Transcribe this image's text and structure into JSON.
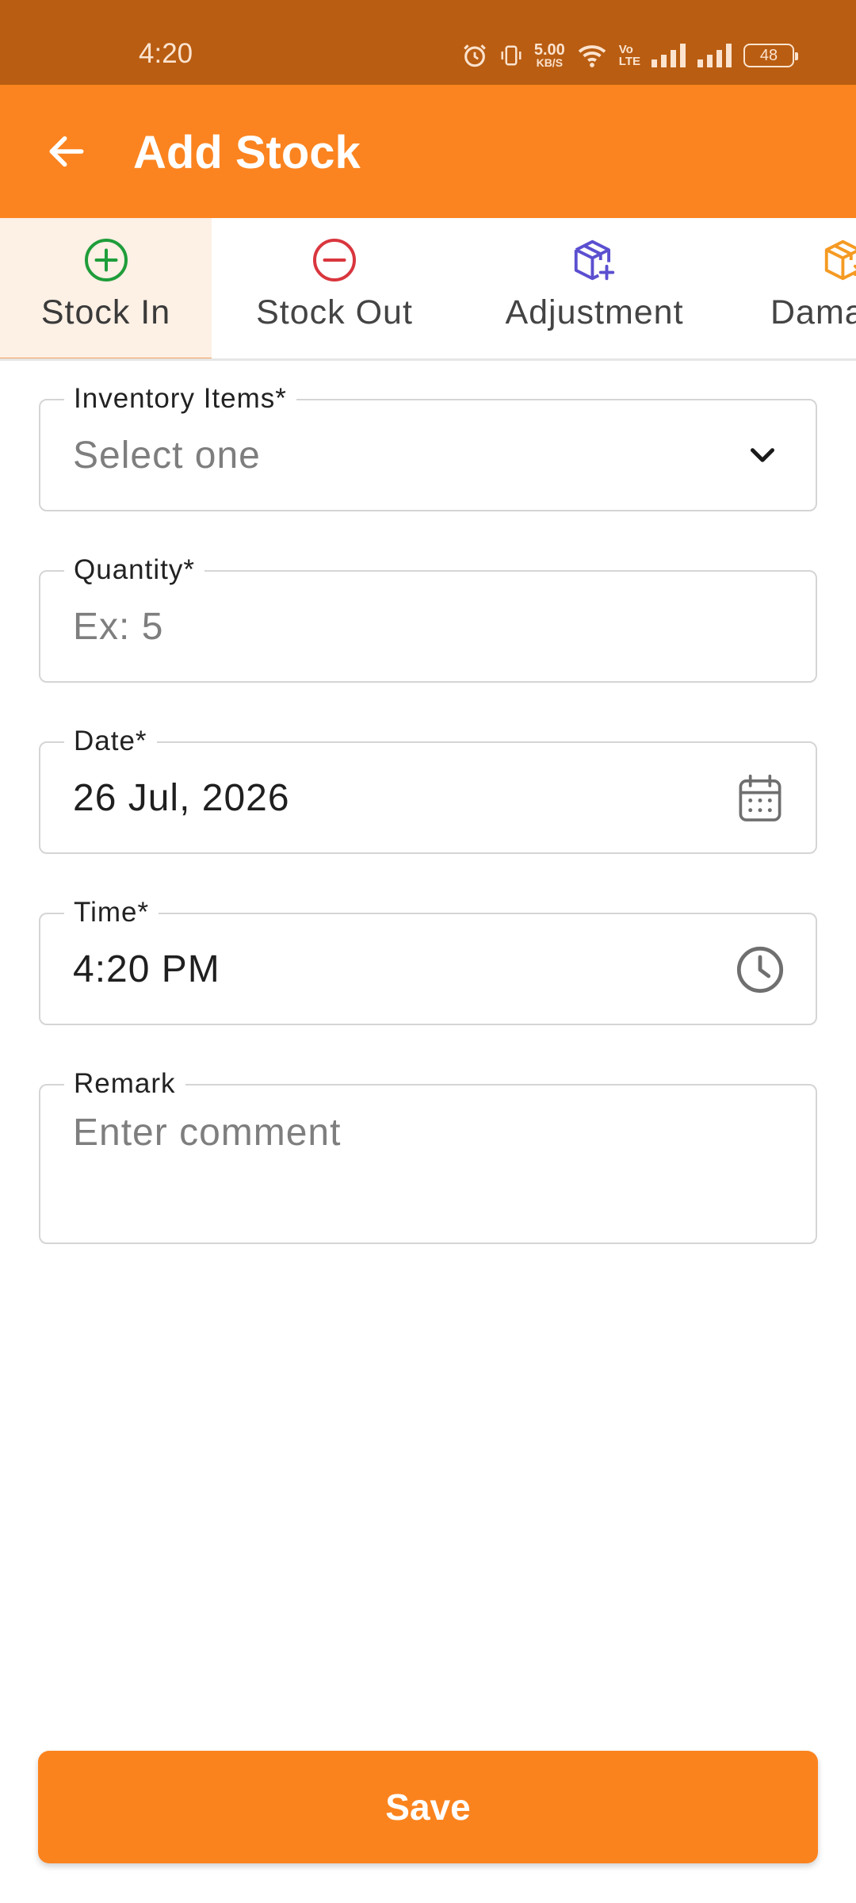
{
  "status_bar": {
    "time": "4:20",
    "net_speed_value": "5.00",
    "net_speed_unit": "KB/S",
    "volte_top": "Vo",
    "volte_bottom": "LTE",
    "battery": "48"
  },
  "app_bar": {
    "title": "Add Stock",
    "back_icon": "arrow-left-icon"
  },
  "tabs": [
    {
      "label": "Stock In",
      "icon": "plus-circle-icon",
      "color": "#1f9d3a",
      "active": true
    },
    {
      "label": "Stock Out",
      "icon": "minus-circle-icon",
      "color": "#d9363e",
      "active": false
    },
    {
      "label": "Adjustment",
      "icon": "box-plus-icon",
      "color": "#5b4fd0",
      "active": false
    },
    {
      "label": "Dama",
      "icon": "box-damaged-icon",
      "color": "#f59a23",
      "active": false
    }
  ],
  "form": {
    "inventory_items": {
      "label": "Inventory Items*",
      "placeholder": "Select one",
      "icon": "chevron-down-icon"
    },
    "quantity": {
      "label": "Quantity*",
      "placeholder": "Ex: 5"
    },
    "date": {
      "label": "Date*",
      "value": "26 Jul, 2026",
      "icon": "calendar-icon"
    },
    "time": {
      "label": "Time*",
      "value": "4:20 PM",
      "icon": "clock-icon"
    },
    "remark": {
      "label": "Remark",
      "placeholder": "Enter comment"
    }
  },
  "save_button": {
    "label": "Save"
  },
  "colors": {
    "status_bar": "#b95d12",
    "accent": "#fb8420",
    "tab_active_bg": "#fdf0e5"
  }
}
